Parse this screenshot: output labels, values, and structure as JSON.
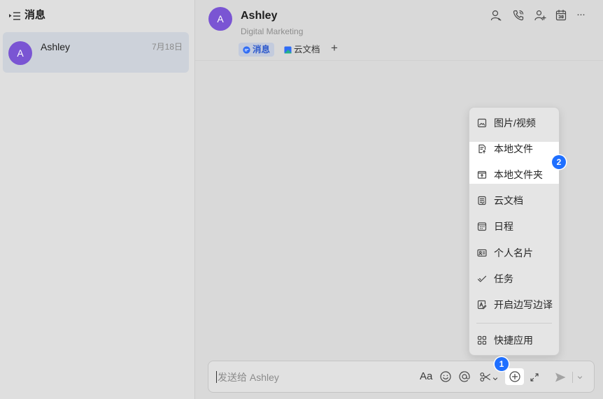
{
  "theme": {
    "accent": "#1f6fff",
    "avatar": "#7a55d3",
    "highlight": "#ffffff"
  },
  "sidebar": {
    "title": "消息",
    "header_icon": "collapse-list-icon",
    "chats": [
      {
        "avatar": "A",
        "name": "Ashley",
        "date": "7月18日",
        "selected": true
      }
    ]
  },
  "chat": {
    "avatar": "A",
    "name": "Ashley",
    "subtitle": "Digital Marketing",
    "header_actions": [
      "search-member-icon",
      "call-icon",
      "add-member-icon",
      "calendar-icon"
    ],
    "more_label": "···",
    "tabs": [
      {
        "label": "消息",
        "icon": "chat-bubble-icon",
        "active": true
      },
      {
        "label": "云文档",
        "icon": "doc-icon",
        "active": false
      }
    ],
    "add_tab_label": "+"
  },
  "attach_menu": {
    "items": [
      {
        "label": "图片/视频",
        "icon": "image-icon"
      },
      {
        "label": "本地文件",
        "icon": "upload-file-icon",
        "highlighted": true
      },
      {
        "label": "本地文件夹",
        "icon": "upload-folder-icon",
        "highlighted": true
      },
      {
        "label": "云文档",
        "icon": "cloud-doc-icon"
      },
      {
        "label": "日程",
        "icon": "schedule-icon"
      },
      {
        "label": "个人名片",
        "icon": "contact-card-icon"
      },
      {
        "label": "任务",
        "icon": "task-icon"
      },
      {
        "label": "开启边写边译",
        "icon": "translate-icon"
      }
    ],
    "footer_item": {
      "label": "快捷应用",
      "icon": "apps-grid-icon"
    }
  },
  "composer": {
    "placeholder": "发送给 Ashley",
    "format_label": "Aa",
    "tools": [
      "emoji-icon",
      "mention-icon",
      "screenshot-icon",
      "chevron-down-icon",
      "plus-circle-icon",
      "expand-icon",
      "send-icon",
      "chevron-down-icon"
    ]
  },
  "annotations": {
    "step_1": "1",
    "step_2": "2"
  }
}
